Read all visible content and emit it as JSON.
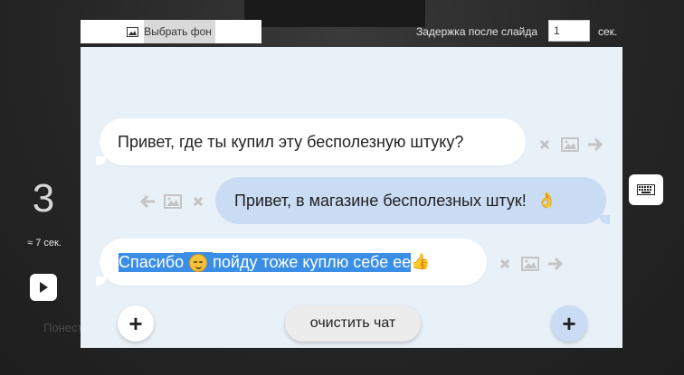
{
  "toolbar": {
    "choose_bg_label": "Выбрать фон",
    "delay_label": "Задержка после слайда",
    "delay_value": "1",
    "delay_unit": "сек."
  },
  "sidebar": {
    "slide_number": "3",
    "duration": "≈ 7 сек.",
    "ghost_text": "Понест"
  },
  "messages": [
    {
      "side": "left",
      "text": "Привет, где ты купил эту бесполезную штуку?"
    },
    {
      "side": "right",
      "text": "Привет, в магазине бесполезных штук!"
    },
    {
      "side": "left",
      "text_a": "Спасибо",
      "text_b": "пойду тоже куплю себе ее",
      "selected": true
    }
  ],
  "controls": {
    "clear_label": "очистить чат",
    "add_left": "+",
    "add_right": "+"
  },
  "icons": [
    "image-icon",
    "close-icon",
    "arrow-right-icon",
    "arrow-left-icon",
    "keyboard-icon",
    "play-icon",
    "ok-hand-emoji",
    "smile-emoji",
    "thumbs-up-emoji"
  ],
  "colors": {
    "chat_bg": "#e8f0f8",
    "bubble_left": "#ffffff",
    "bubble_right": "#c9dcf3",
    "selection": "#3a8ee6"
  }
}
